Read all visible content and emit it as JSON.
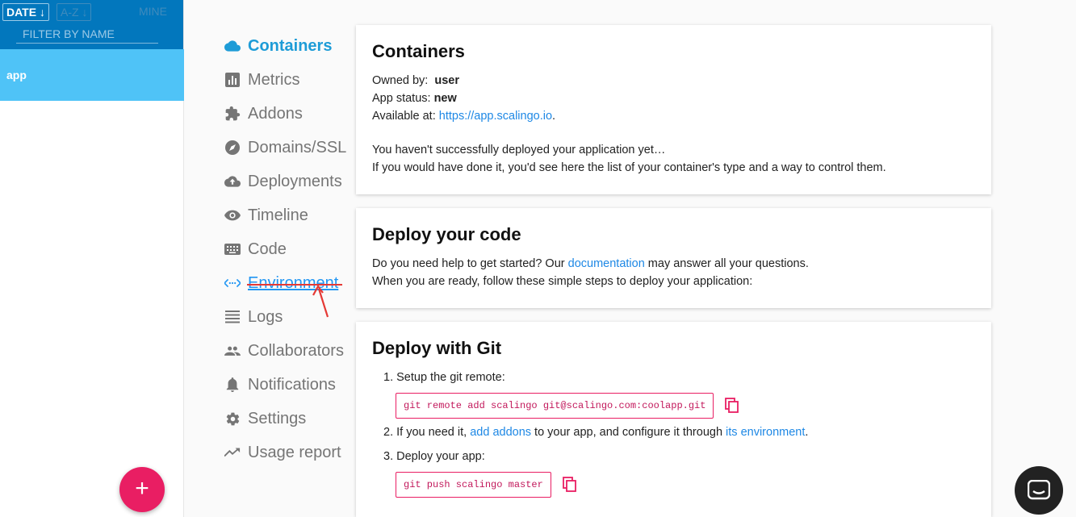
{
  "applist": {
    "sort_date": "DATE ↓",
    "sort_az": "A-Z ↓",
    "mine": "MINE",
    "filter_placeholder": "FILTER BY NAME",
    "app_name": "app",
    "add_label": "+"
  },
  "nav": {
    "items": [
      {
        "label": "Containers",
        "icon": "cloud-icon"
      },
      {
        "label": "Metrics",
        "icon": "chart-icon"
      },
      {
        "label": "Addons",
        "icon": "puzzle-icon"
      },
      {
        "label": "Domains/SSL",
        "icon": "compass-icon"
      },
      {
        "label": "Deployments",
        "icon": "upload-cloud-icon"
      },
      {
        "label": "Timeline",
        "icon": "eye-icon"
      },
      {
        "label": "Code",
        "icon": "keyboard-icon"
      },
      {
        "label": "Environment",
        "icon": "code-icon"
      },
      {
        "label": "Logs",
        "icon": "lines-icon"
      },
      {
        "label": "Collaborators",
        "icon": "people-icon"
      },
      {
        "label": "Notifications",
        "icon": "bell-icon"
      },
      {
        "label": "Settings",
        "icon": "gear-icon"
      },
      {
        "label": "Usage report",
        "icon": "trending-icon"
      }
    ],
    "active": "Containers"
  },
  "containers": {
    "title": "Containers",
    "owned_label": "Owned by:",
    "owned_value": "user",
    "status_label": "App status:",
    "status_value": "new",
    "available_label": "Available at:",
    "available_url": "https://app.scalingo.io",
    "not_deployed": "You haven't successfully deployed your application yet…",
    "hint": "If you would have done it, you'd see here the list of your container's type and a way to control them."
  },
  "deploy": {
    "title": "Deploy your code",
    "line1_pre": "Do you need help to get started? Our",
    "line1_link": "documentation",
    "line1_post": "may answer all your questions.",
    "line2": "When you are ready, follow these simple steps to deploy your application:"
  },
  "git": {
    "title": "Deploy with Git",
    "step1": "1. Setup the git remote:",
    "cmd1": "git remote add scalingo git@scalingo.com:coolapp.git",
    "step2_pre": "2. If you need it,",
    "step2_link1": "add addons",
    "step2_mid": "to your app, and configure it through",
    "step2_link2": "its environment",
    "step2_post": ".",
    "step3": "3. Deploy your app:",
    "cmd2": "git push scalingo master"
  },
  "colors": {
    "header_blue": "#0277bd",
    "app_selected": "#4fc3f7",
    "fab": "#e91e63",
    "active_nav": "#1e9cd7",
    "annotation_red": "#e53935"
  }
}
